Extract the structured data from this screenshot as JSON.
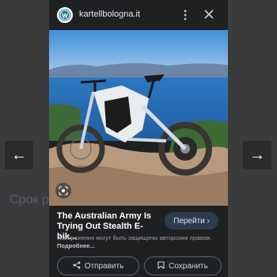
{
  "background": {
    "partial_text": "Срок р"
  },
  "nav": {
    "prev_glyph": "←",
    "next_glyph": "→"
  },
  "card": {
    "site_name": "kartellbologna.it",
    "title": "The Australian Army Is Trying Out Stealth E-bik...",
    "open_label": "Перейти",
    "disclaimer": "Изображения могут быть защищены авторским правом.",
    "more_link": "Подробнее...",
    "share_label": "Отправить",
    "save_label": "Сохранить"
  },
  "icons": {
    "site_logo": "wordpress-icon",
    "more": "more-vertical-icon",
    "close": "close-icon",
    "lens": "google-lens-icon",
    "share": "share-icon",
    "save": "bookmark-icon"
  },
  "colors": {
    "page_background": "#3a3b3d",
    "card_background": "#1f2022",
    "open_button_background": "#2f3a4e",
    "open_button_text": "#d7e3fc"
  }
}
